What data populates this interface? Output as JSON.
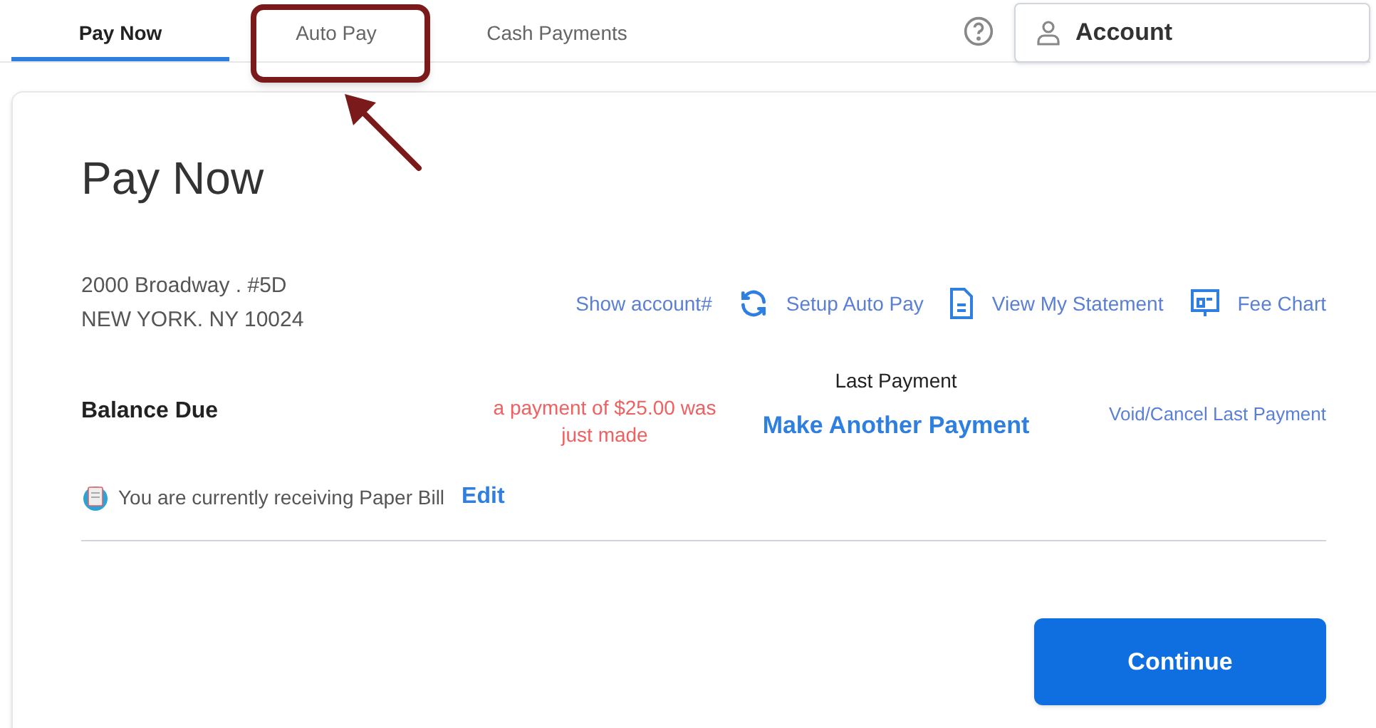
{
  "tabs": [
    {
      "label": "Pay Now",
      "selected": true,
      "highlighted": false
    },
    {
      "label": "Auto Pay",
      "selected": false,
      "highlighted": true
    },
    {
      "label": "Cash Payments",
      "selected": false,
      "highlighted": false
    }
  ],
  "account_menu": {
    "label": "Account"
  },
  "page": {
    "title": "Pay Now",
    "address": [
      "2000 Broadway . #5D",
      "NEW YORK. NY 10024"
    ],
    "links": [
      {
        "label": "Show account#"
      },
      {
        "label": "Setup Auto Pay"
      },
      {
        "label": "View My Statement"
      },
      {
        "label": "Fee Chart"
      }
    ],
    "balance_label": "Balance Due",
    "payment_notice": "a payment of $25.00 was just made",
    "last_payment_label": "Last Payment",
    "make_payment": "Make Another Payment",
    "void_link": "Void/Cancel Last Payment",
    "paper_bill": {
      "text": "You are currently receiving Paper Bill",
      "edit": "Edit"
    },
    "continue": "Continue"
  }
}
